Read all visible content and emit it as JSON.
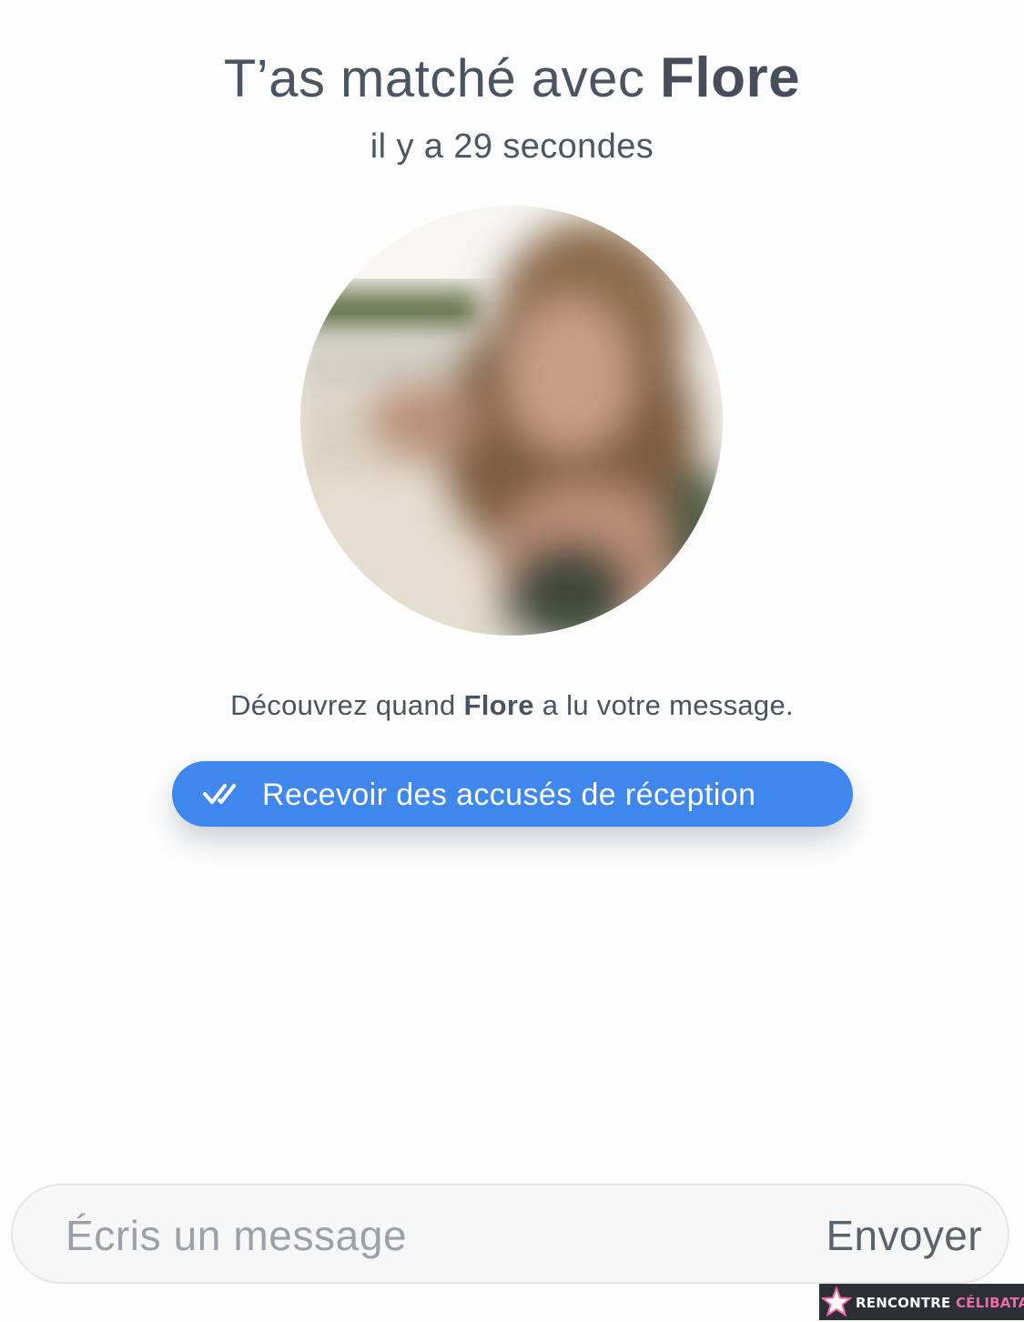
{
  "match": {
    "title_prefix": "T’as matché avec",
    "name": "Flore",
    "time_ago": "il y a 29 secondes"
  },
  "receipts": {
    "prompt_prefix": "Découvrez quand",
    "prompt_name": "Flore",
    "prompt_suffix": "a lu votre message.",
    "button_label": "Recevoir des accusés de réception",
    "button_icon": "double-check-icon"
  },
  "composer": {
    "placeholder": "Écris un message",
    "send_label": "Envoyer"
  },
  "watermark": {
    "part1": "RENCONTRE",
    "part2": "CÉLIBATAIRE"
  },
  "colors": {
    "accent": "#3f87ec",
    "text": "#4a5360",
    "placeholder": "#9ba0a9",
    "background": "#fdfdfd"
  }
}
